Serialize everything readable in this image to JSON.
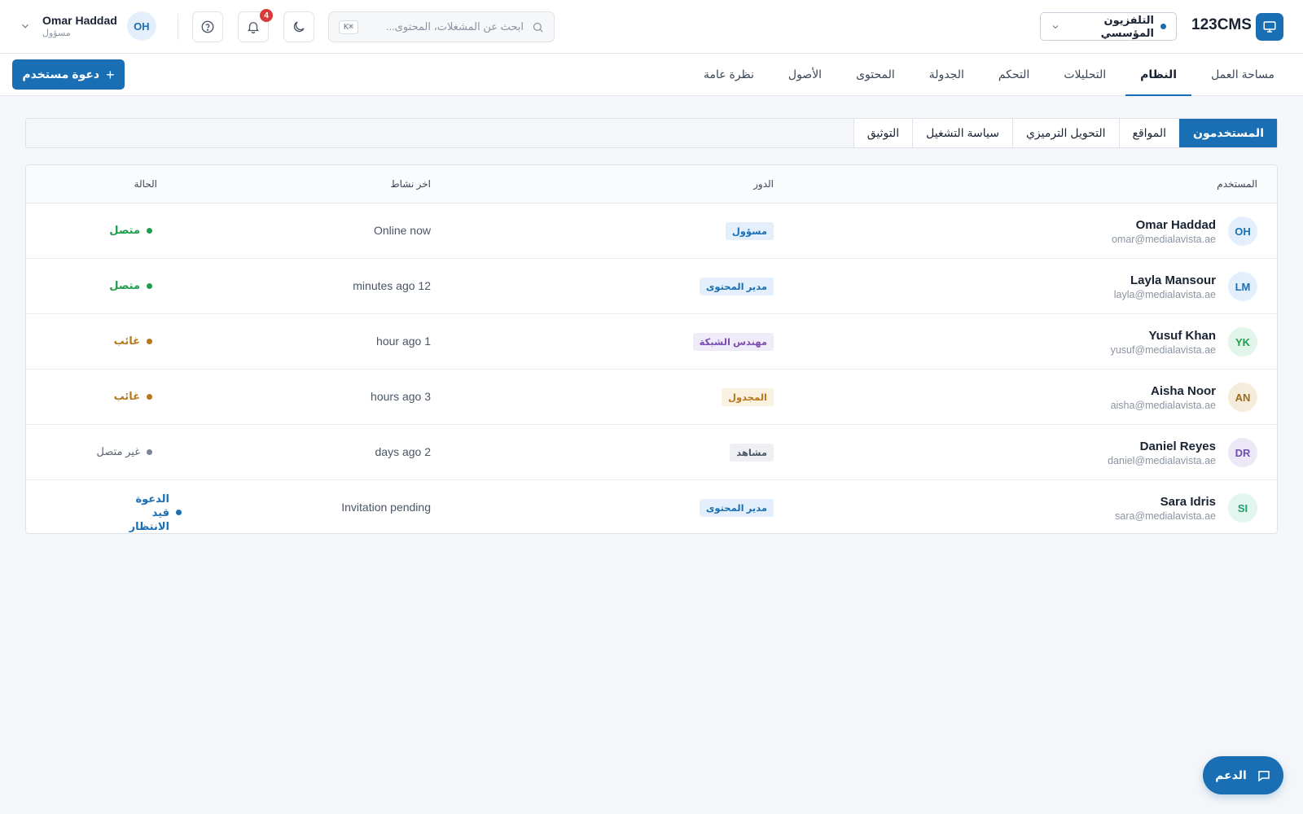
{
  "header": {
    "user": {
      "name": "Omar Haddad",
      "role": "مسؤول",
      "initials": "OH"
    },
    "notifications_count": "4",
    "search": {
      "placeholder": "ابحث عن المشغلات، المحتوى...",
      "shortcut": "K⌘"
    },
    "display_selector": {
      "label": "التلفزيون المؤسسي",
      "indicator_color": "#1a6fb4"
    },
    "brand": {
      "name": "123CMS",
      "logo_icon": "monitor-icon"
    }
  },
  "nav": {
    "invite_button": "دعوة مستخدم",
    "tabs": [
      {
        "label": "نظرة عامة",
        "active": false
      },
      {
        "label": "الأصول",
        "active": false
      },
      {
        "label": "المحتوى",
        "active": false
      },
      {
        "label": "الجدولة",
        "active": false
      },
      {
        "label": "التحكم",
        "active": false
      },
      {
        "label": "التحليلات",
        "active": false
      },
      {
        "label": "النظام",
        "active": true
      },
      {
        "label": "مساحة العمل",
        "active": false
      }
    ]
  },
  "subtabs": [
    {
      "label": "المستخدمون",
      "active": true
    },
    {
      "label": "المواقع",
      "active": false
    },
    {
      "label": "التحويل الترميزي",
      "active": false
    },
    {
      "label": "سياسة التشغيل",
      "active": false
    },
    {
      "label": "التوثيق",
      "active": false
    }
  ],
  "table": {
    "headers": {
      "user": "المستخدم",
      "role": "الدور",
      "last_activity": "اخر نشاط",
      "status": "الحالة"
    },
    "rows": [
      {
        "initials": "OH",
        "name": "Omar Haddad",
        "email": "omar@medialavista.ae",
        "role": "مسؤول",
        "activity": "Online now",
        "status": "متصل",
        "status_kind": "online"
      },
      {
        "initials": "LM",
        "name": "Layla Mansour",
        "email": "layla@medialavista.ae",
        "role": "مدير المحتوى",
        "activity": "minutes ago 12",
        "status": "متصل",
        "status_kind": "online"
      },
      {
        "initials": "YK",
        "name": "Yusuf Khan",
        "email": "yusuf@medialavista.ae",
        "role": "مهندس الشبكة",
        "activity": "hour ago 1",
        "status": "غائب",
        "status_kind": "away"
      },
      {
        "initials": "AN",
        "name": "Aisha Noor",
        "email": "aisha@medialavista.ae",
        "role": "المجدول",
        "activity": "hours ago 3",
        "status": "غائب",
        "status_kind": "away"
      },
      {
        "initials": "DR",
        "name": "Daniel Reyes",
        "email": "daniel@medialavista.ae",
        "role": "مشاهد",
        "activity": "days ago 2",
        "status": "غير متصل",
        "status_kind": "offline"
      },
      {
        "initials": "SI",
        "name": "Sara Idris",
        "email": "sara@medialavista.ae",
        "role": "مدير المحتوى",
        "activity": "Invitation pending",
        "status": "الدعوة قيد الانتظار",
        "status_kind": "pending"
      }
    ]
  },
  "support": {
    "label": "الدعم"
  },
  "colors": {
    "primary": "#1a6fb4",
    "online": "#1f9d4a",
    "away": "#b7791f",
    "offline": "#7a8494",
    "pending": "#1a6fb4"
  }
}
